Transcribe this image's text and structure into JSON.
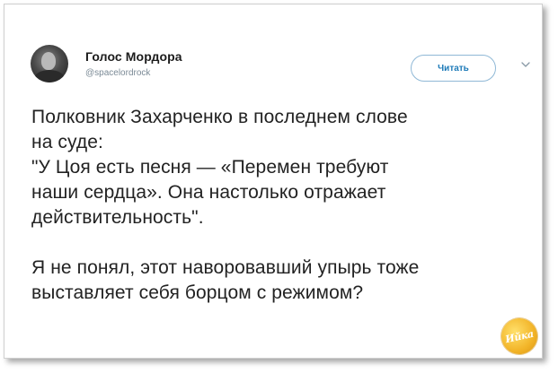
{
  "tweet": {
    "author": {
      "display_name": "Голос Мордора",
      "handle": "@spacelordrock"
    },
    "follow_label": "Читать",
    "menu_icon": "chevron-down-icon",
    "text": "Полковник Захарченко в последнем слове\nна суде:\n\"У Цоя есть песня — «Перемен требуют\nнаши сердца». Она настолько отражает\nдействительность\".\n\nЯ не понял, этот наворовавший упырь тоже\nвыставляет себя борцом с режимом?"
  },
  "watermark": {
    "text": "Ийка",
    "color": "#f2b428"
  },
  "colors": {
    "accent": "#1d7ab8",
    "text": "#222222",
    "handle": "#7b8a96"
  }
}
